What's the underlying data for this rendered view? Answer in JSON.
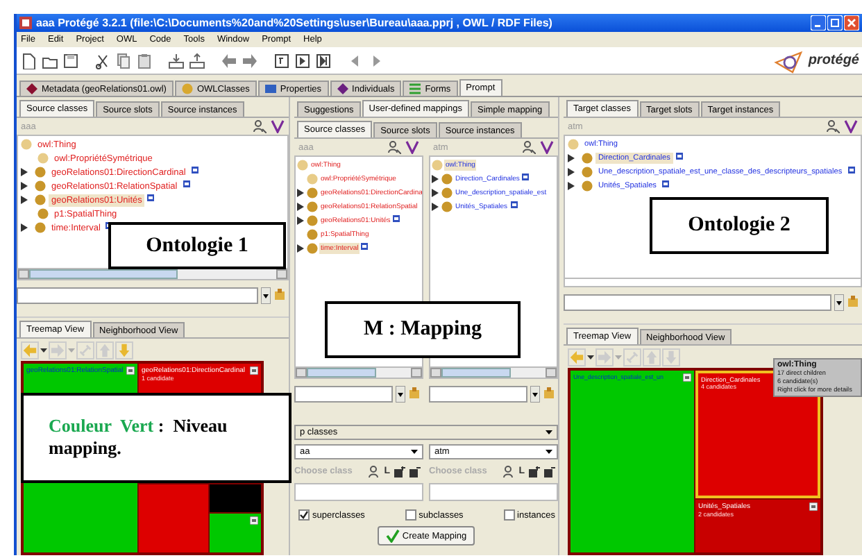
{
  "window": {
    "title": "aaa  Protégé 3.2.1    (file:\\C:\\Documents%20and%20Settings\\user\\Bureau\\aaa.pprj , OWL / RDF Files)"
  },
  "menu": [
    "File",
    "Edit",
    "Project",
    "OWL",
    "Code",
    "Tools",
    "Window",
    "Prompt",
    "Help"
  ],
  "logo": "protégé",
  "tabs": [
    {
      "label": "Metadata (geoRelations01.owl)",
      "kind": "metadata",
      "selected": false
    },
    {
      "label": "OWLClasses",
      "kind": "classes",
      "selected": false
    },
    {
      "label": "Properties",
      "kind": "properties",
      "selected": false
    },
    {
      "label": "Individuals",
      "kind": "individuals",
      "selected": false
    },
    {
      "label": "Forms",
      "kind": "forms",
      "selected": false
    },
    {
      "label": "Prompt",
      "kind": "plain",
      "selected": true
    }
  ],
  "source": {
    "tabs": [
      {
        "label": "Source classes",
        "selected": true
      },
      {
        "label": "Source slots",
        "selected": false
      },
      {
        "label": "Source instances",
        "selected": false
      }
    ],
    "ontology": "aaa",
    "tree": [
      {
        "label": "owl:Thing",
        "kind": "root",
        "pale": true,
        "mapped": false,
        "selected": false
      },
      {
        "label": "owl:PropriétéSymétrique",
        "kind": "leaf",
        "pale": true,
        "mapped": false,
        "selected": false
      },
      {
        "label": "geoRelations01:DirectionCardinal",
        "kind": "branch",
        "pale": false,
        "mapped": true,
        "selected": false
      },
      {
        "label": "geoRelations01:RelationSpatial",
        "kind": "branch",
        "pale": false,
        "mapped": true,
        "selected": false
      },
      {
        "label": "geoRelations01:Unités",
        "kind": "branch",
        "pale": false,
        "mapped": true,
        "selected": true
      },
      {
        "label": "p1:SpatialThing",
        "kind": "leaf",
        "pale": false,
        "mapped": false,
        "selected": false
      },
      {
        "label": "time:Interval",
        "kind": "branch",
        "pale": false,
        "mapped": true,
        "selected": false
      }
    ],
    "treemap_tabs": [
      {
        "label": "Treemap View",
        "selected": true
      },
      {
        "label": "Neighborhood View",
        "selected": false
      }
    ],
    "treemap": [
      {
        "label": "geoRelations01:RelationSpatial",
        "kind": "mapped",
        "badge": true,
        "selected": false
      },
      {
        "label": "geoRelations01:DirectionCardinal",
        "detail": "1 candidate",
        "kind": "candidate",
        "badge": true,
        "selected": false
      },
      {
        "kind": "candidate",
        "badge": false,
        "selected": false
      },
      {
        "kind": "dark",
        "badge": false,
        "selected": false
      },
      {
        "kind": "mapped",
        "badge": true,
        "selected": false
      }
    ]
  },
  "mapping": {
    "tabs": [
      {
        "label": "Suggestions",
        "selected": false
      },
      {
        "label": "User-defined mappings",
        "selected": true
      },
      {
        "label": "Simple mapping",
        "selected": false
      }
    ],
    "inner_tabs": [
      {
        "label": "Source classes",
        "selected": true
      },
      {
        "label": "Source slots",
        "selected": false
      },
      {
        "label": "Source instances",
        "selected": false
      }
    ],
    "trees": [
      {
        "ontology": "aaa",
        "kind": "source",
        "items": [
          {
            "label": "owl:Thing",
            "kind": "root",
            "pale": true,
            "mapped": false,
            "selected": false
          },
          {
            "label": "owl:PropriétéSymétrique",
            "kind": "leaf",
            "pale": true,
            "mapped": false,
            "selected": false
          },
          {
            "label": "geoRelations01:DirectionCardina",
            "kind": "branch",
            "pale": false,
            "mapped": false,
            "selected": false
          },
          {
            "label": "geoRelations01:RelationSpatial",
            "kind": "branch",
            "pale": false,
            "mapped": false,
            "selected": false
          },
          {
            "label": "geoRelations01:Unités",
            "kind": "branch",
            "pale": false,
            "mapped": true,
            "selected": false
          },
          {
            "label": "p1:SpatialThing",
            "kind": "leaf",
            "pale": false,
            "mapped": false,
            "selected": false
          },
          {
            "label": "time:Interval",
            "kind": "branch",
            "pale": false,
            "mapped": true,
            "selected": true
          }
        ]
      },
      {
        "ontology": "atm",
        "kind": "target",
        "items": [
          {
            "label": "owl:Thing",
            "kind": "root",
            "pale": true,
            "mapped": false,
            "selected": true
          },
          {
            "label": "Direction_Cardinales",
            "kind": "branch",
            "pale": false,
            "mapped": true,
            "selected": false
          },
          {
            "label": "Une_description_spatiale_est",
            "kind": "branch",
            "pale": false,
            "mapped": false,
            "selected": false
          },
          {
            "label": "Unités_Spatiales",
            "kind": "branch",
            "pale": false,
            "mapped": true,
            "selected": false
          }
        ]
      }
    ],
    "relation": "p classes",
    "choosers": [
      {
        "selection": "aa",
        "label": "Choose class",
        "key": "L"
      },
      {
        "selection": "atm",
        "label": "Choose class",
        "key": "L"
      }
    ],
    "options": [
      {
        "label": "superclasses",
        "checked": true
      },
      {
        "label": "subclasses",
        "checked": false
      },
      {
        "label": "instances",
        "checked": false
      }
    ],
    "button": "Create Mapping"
  },
  "target": {
    "tabs": [
      {
        "label": "Target classes",
        "selected": true
      },
      {
        "label": "Target slots",
        "selected": false
      },
      {
        "label": "Target instances",
        "selected": false
      }
    ],
    "ontology": "atm",
    "tree": [
      {
        "label": "owl:Thing",
        "kind": "root",
        "pale": true,
        "mapped": false,
        "selected": false
      },
      {
        "label": "Direction_Cardinales",
        "kind": "branch",
        "pale": false,
        "mapped": true,
        "selected": true
      },
      {
        "label": "Une_description_spatiale_est_une_classe_des_descripteurs_spatiales",
        "kind": "branch",
        "pale": false,
        "mapped": true,
        "selected": false
      },
      {
        "label": "Unités_Spatiales",
        "kind": "branch",
        "pale": false,
        "mapped": true,
        "selected": false
      }
    ],
    "treemap_tabs": [
      {
        "label": "Treemap View",
        "selected": true
      },
      {
        "label": "Neighborhood View",
        "selected": false
      }
    ],
    "treemap": [
      {
        "label": "Une_description_spatiale_est_un",
        "kind": "mapped",
        "badge": true,
        "selected": false
      },
      {
        "label": "Direction_Cardinales",
        "detail": "4 candidates",
        "kind": "candidate",
        "badge": false,
        "selected": true
      },
      {
        "label": "Unités_Spatiales",
        "detail": "2 candidates",
        "kind": "candidate",
        "badge": true,
        "selected": false
      }
    ],
    "tooltip": {
      "title": "owl:Thing",
      "lines": [
        "17 direct children",
        "6 candidate(s)",
        "Right click for more details"
      ]
    }
  },
  "notes": [
    {
      "text": "Ontologie 1"
    },
    {
      "lead": "Couleur  Vert",
      "text": " :  Niveau mapping."
    },
    {
      "text": "M : Mapping"
    },
    {
      "text": "Ontologie 2"
    }
  ]
}
